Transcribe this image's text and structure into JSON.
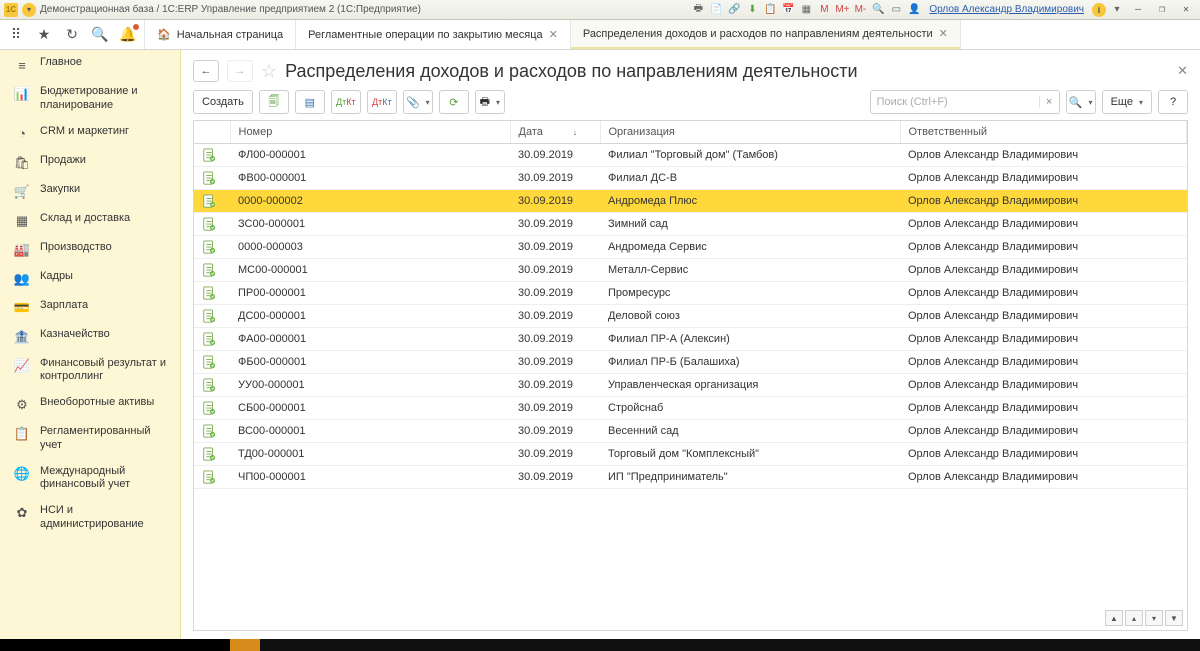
{
  "titlebar": {
    "logo_text": "1C",
    "title": "Демонстрационная база / 1С:ERP Управление предприятием 2  (1С:Предприятие)",
    "user": "Орлов Александр Владимирович",
    "m_labels": [
      "M",
      "M+",
      "M-"
    ]
  },
  "tabs": {
    "home": "Начальная страница",
    "tab1": "Регламентные операции по закрытию месяца",
    "tab2": "Распределения доходов и расходов по направлениям деятельности"
  },
  "sidebar": [
    {
      "icon": "≡",
      "label": "Главное"
    },
    {
      "icon": "📊",
      "label": "Бюджетирование и планирование"
    },
    {
      "icon": "◔",
      "label": "CRM и маркетинг"
    },
    {
      "icon": "🛍",
      "label": "Продажи"
    },
    {
      "icon": "🛒",
      "label": "Закупки"
    },
    {
      "icon": "▦",
      "label": "Склад и доставка"
    },
    {
      "icon": "🏭",
      "label": "Производство"
    },
    {
      "icon": "👥",
      "label": "Кадры"
    },
    {
      "icon": "💳",
      "label": "Зарплата"
    },
    {
      "icon": "🏦",
      "label": "Казначейство"
    },
    {
      "icon": "📈",
      "label": "Финансовый результат и контроллинг"
    },
    {
      "icon": "⚙",
      "label": "Внеоборотные активы"
    },
    {
      "icon": "📋",
      "label": "Регламентированный учет"
    },
    {
      "icon": "🌐",
      "label": "Международный финансовый учет"
    },
    {
      "icon": "✿",
      "label": "НСИ и администрирование"
    }
  ],
  "page": {
    "title": "Распределения доходов и расходов по направлениям деятельности",
    "create_label": "Создать",
    "more_label": "Еще",
    "search_placeholder": "Поиск (Ctrl+F)"
  },
  "columns": {
    "number": "Номер",
    "date": "Дата",
    "org": "Организация",
    "responsible": "Ответственный"
  },
  "rows": [
    {
      "num": "ФЛ00-000001",
      "date": "30.09.2019",
      "org": "Филиал \"Торговый дом\" (Тамбов)",
      "resp": "Орлов Александр Владимирович",
      "sel": false
    },
    {
      "num": "ФВ00-000001",
      "date": "30.09.2019",
      "org": "Филиал ДС-В",
      "resp": "Орлов Александр Владимирович",
      "sel": false
    },
    {
      "num": "0000-000002",
      "date": "30.09.2019",
      "org": "Андромеда Плюс",
      "resp": "Орлов Александр Владимирович",
      "sel": true
    },
    {
      "num": "ЗС00-000001",
      "date": "30.09.2019",
      "org": "Зимний сад",
      "resp": "Орлов Александр Владимирович",
      "sel": false
    },
    {
      "num": "0000-000003",
      "date": "30.09.2019",
      "org": "Андромеда Сервис",
      "resp": "Орлов Александр Владимирович",
      "sel": false
    },
    {
      "num": "МС00-000001",
      "date": "30.09.2019",
      "org": "Металл-Сервис",
      "resp": "Орлов Александр Владимирович",
      "sel": false
    },
    {
      "num": "ПР00-000001",
      "date": "30.09.2019",
      "org": "Промресурс",
      "resp": "Орлов Александр Владимирович",
      "sel": false
    },
    {
      "num": "ДС00-000001",
      "date": "30.09.2019",
      "org": "Деловой союз",
      "resp": "Орлов Александр Владимирович",
      "sel": false
    },
    {
      "num": "ФА00-000001",
      "date": "30.09.2019",
      "org": "Филиал ПР-А (Алексин)",
      "resp": "Орлов Александр Владимирович",
      "sel": false
    },
    {
      "num": "ФБ00-000001",
      "date": "30.09.2019",
      "org": "Филиал ПР-Б (Балашиха)",
      "resp": "Орлов Александр Владимирович",
      "sel": false
    },
    {
      "num": "УУ00-000001",
      "date": "30.09.2019",
      "org": "Управленческая организация",
      "resp": "Орлов Александр Владимирович",
      "sel": false
    },
    {
      "num": "СБ00-000001",
      "date": "30.09.2019",
      "org": "Стройснаб",
      "resp": "Орлов Александр Владимирович",
      "sel": false
    },
    {
      "num": "ВС00-000001",
      "date": "30.09.2019",
      "org": "Весенний сад",
      "resp": "Орлов Александр Владимирович",
      "sel": false
    },
    {
      "num": "ТД00-000001",
      "date": "30.09.2019",
      "org": "Торговый дом \"Комплексный\"",
      "resp": "Орлов Александр Владимирович",
      "sel": false
    },
    {
      "num": "ЧП00-000001",
      "date": "30.09.2019",
      "org": "ИП \"Предприниматель\"",
      "resp": "Орлов Александр Владимирович",
      "sel": false
    }
  ]
}
